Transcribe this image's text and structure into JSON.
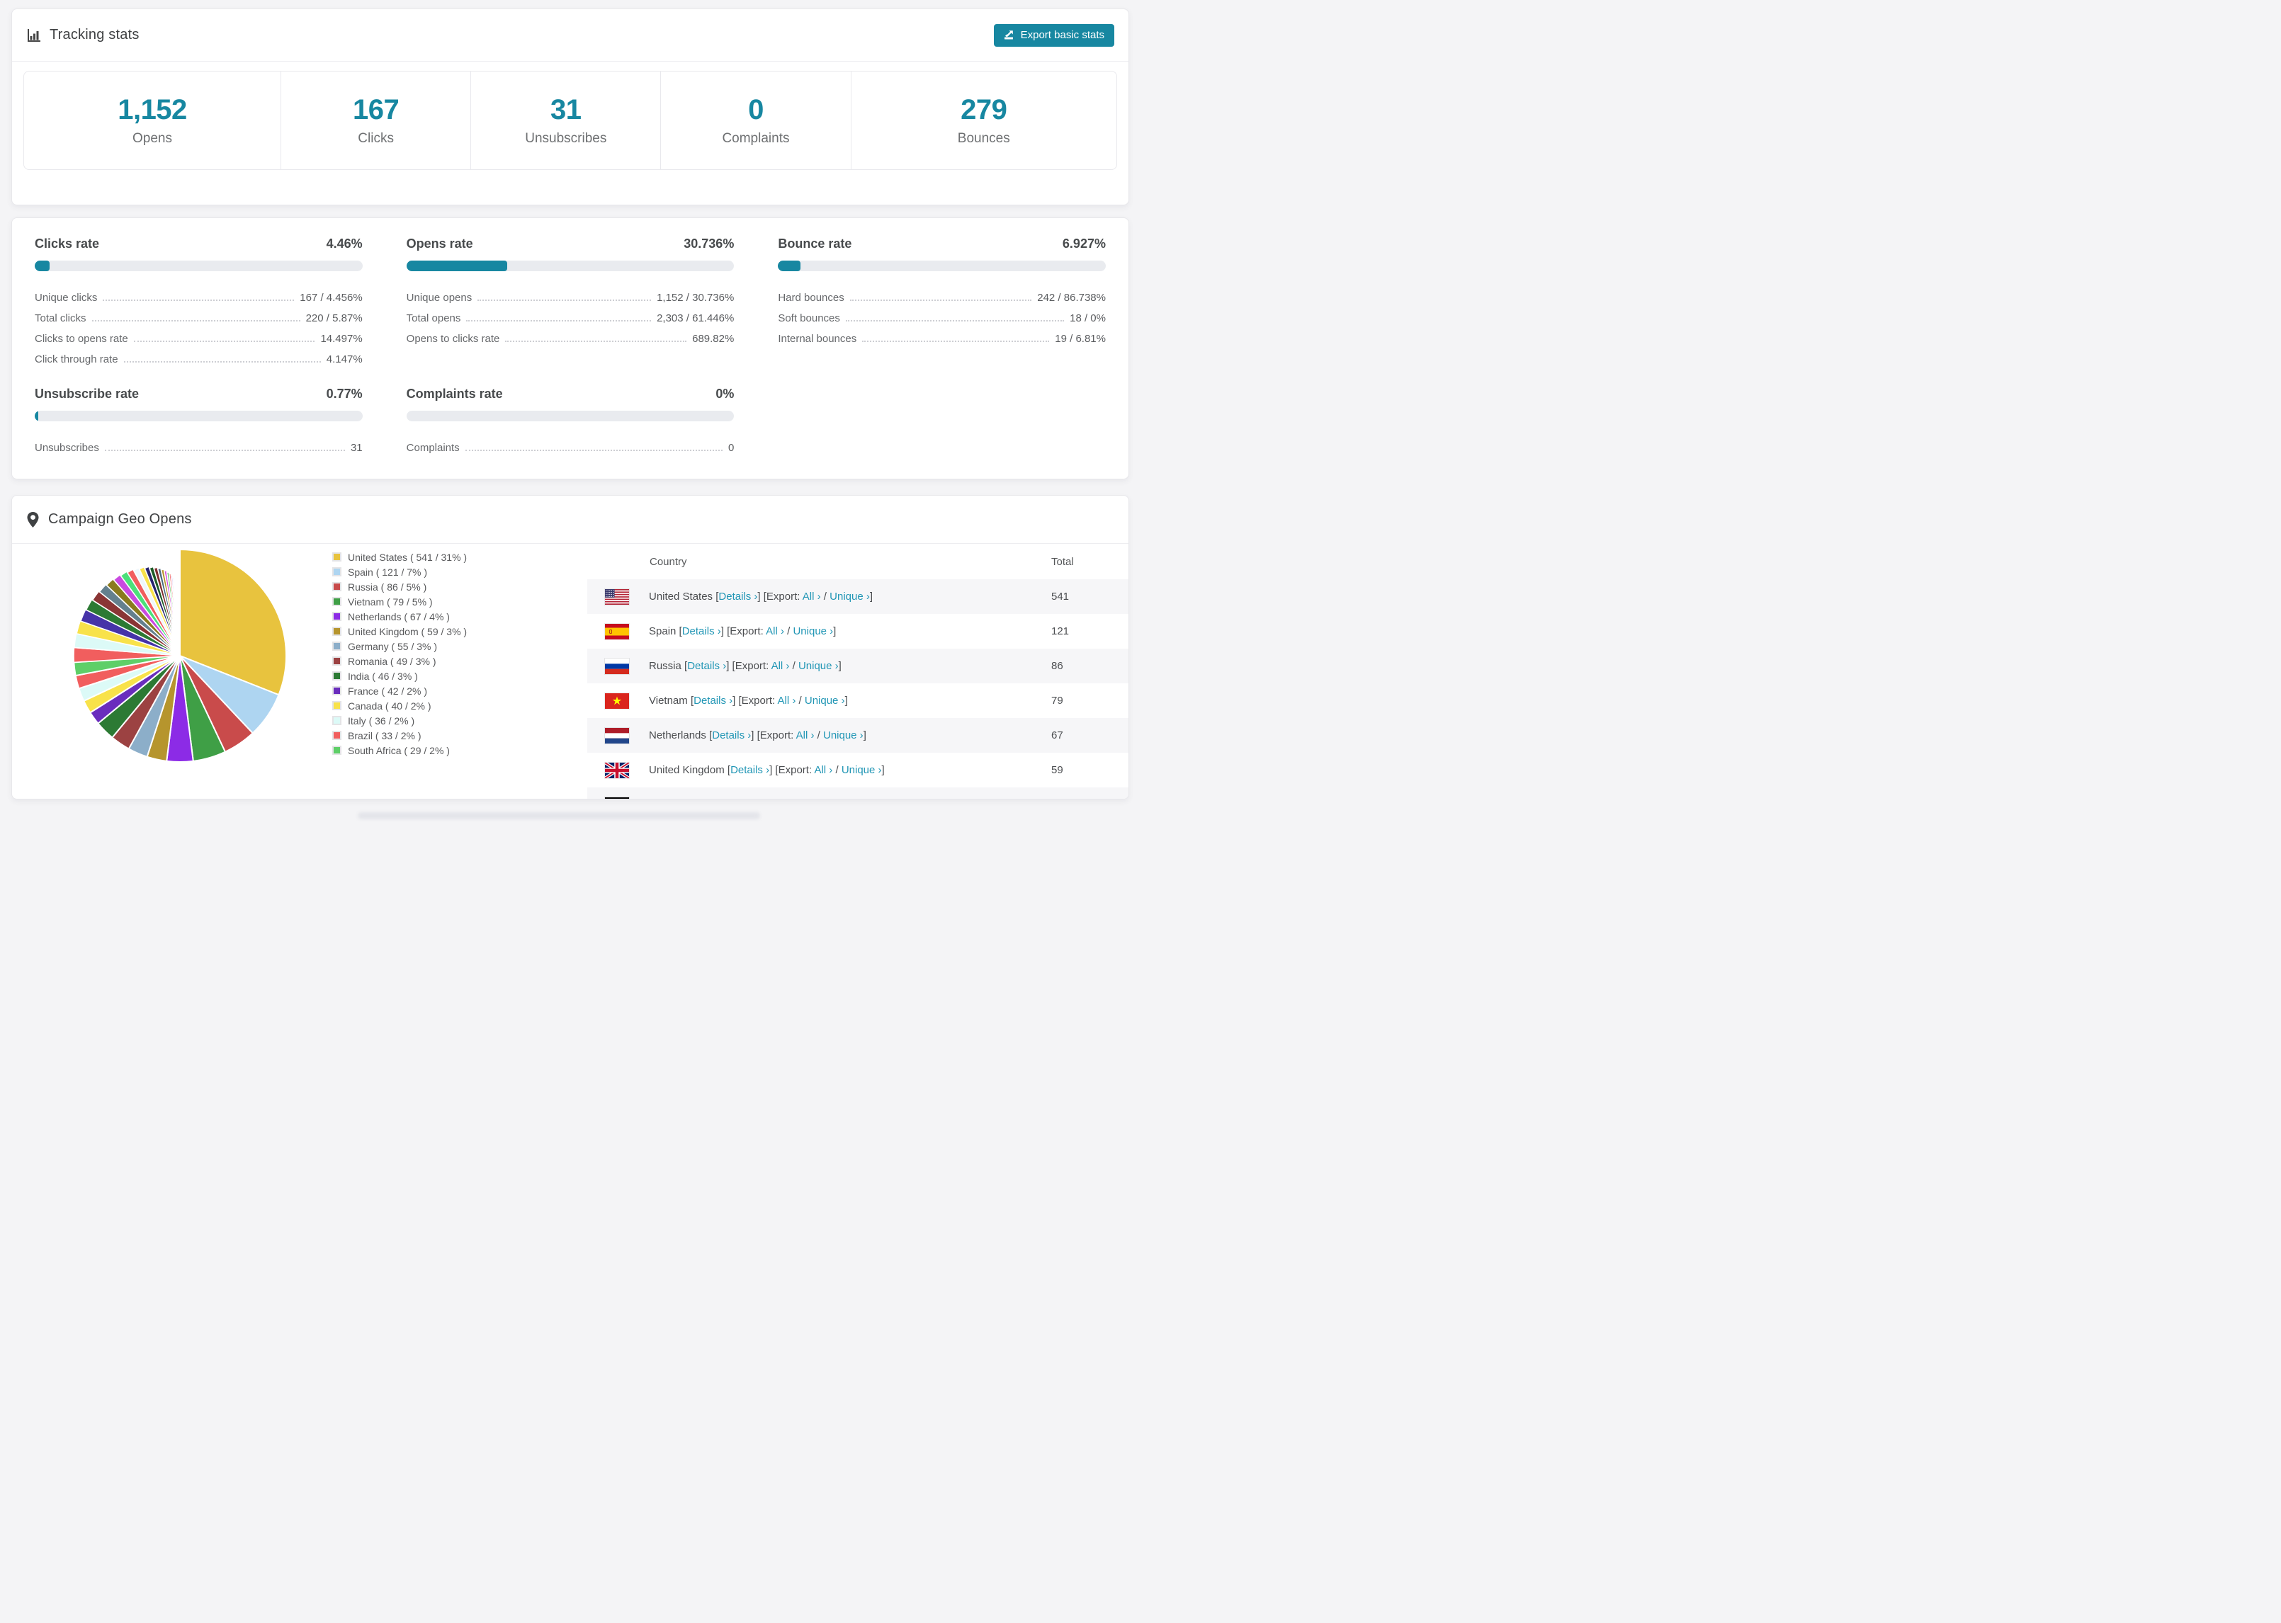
{
  "colors": {
    "accent": "#1787a1",
    "link": "#2196b5",
    "track": "#e9ebef",
    "page_bg": "#f4f4f6"
  },
  "tracking": {
    "title": "Tracking stats",
    "export_label": "Export basic stats",
    "stats": [
      {
        "value": "1,152",
        "label": "Opens"
      },
      {
        "value": "167",
        "label": "Clicks"
      },
      {
        "value": "31",
        "label": "Unsubscribes"
      },
      {
        "value": "0",
        "label": "Complaints"
      },
      {
        "value": "279",
        "label": "Bounces"
      }
    ]
  },
  "rates": [
    {
      "title": "Clicks rate",
      "value": "4.46%",
      "percent": 4.46,
      "rows": [
        [
          "Unique clicks",
          "167 / 4.456%"
        ],
        [
          "Total clicks",
          "220 / 5.87%"
        ],
        [
          "Clicks to opens rate",
          "14.497%"
        ],
        [
          "Click through rate",
          "4.147%"
        ]
      ]
    },
    {
      "title": "Opens rate",
      "value": "30.736%",
      "percent": 30.736,
      "rows": [
        [
          "Unique opens",
          "1,152 / 30.736%"
        ],
        [
          "Total opens",
          "2,303 / 61.446%"
        ],
        [
          "Opens to clicks rate",
          "689.82%"
        ]
      ]
    },
    {
      "title": "Bounce rate",
      "value": "6.927%",
      "percent": 6.927,
      "rows": [
        [
          "Hard bounces",
          "242 / 86.738%"
        ],
        [
          "Soft bounces",
          "18 / 0%"
        ],
        [
          "Internal bounces",
          "19 / 6.81%"
        ]
      ]
    },
    {
      "title": "Unsubscribe rate",
      "value": "0.77%",
      "percent": 0.77,
      "rows": [
        [
          "Unsubscribes",
          "31"
        ]
      ]
    },
    {
      "title": "Complaints rate",
      "value": "0%",
      "percent": 0,
      "rows": [
        [
          "Complaints",
          "0"
        ]
      ]
    }
  ],
  "geo": {
    "title": "Campaign Geo Opens",
    "table": {
      "col_country": "Country",
      "col_total": "Total",
      "details_label": "Details",
      "export_label": "Export:",
      "all_label": "All",
      "unique_label": "Unique",
      "chevron": "›",
      "rows": [
        {
          "country": "United States",
          "flag": "us",
          "total": "541"
        },
        {
          "country": "Spain",
          "flag": "es",
          "total": "121"
        },
        {
          "country": "Russia",
          "flag": "ru",
          "total": "86"
        },
        {
          "country": "Vietnam",
          "flag": "vn",
          "total": "79"
        },
        {
          "country": "Netherlands",
          "flag": "nl",
          "total": "67"
        },
        {
          "country": "United Kingdom",
          "flag": "gb",
          "total": "59"
        }
      ],
      "partial_row": {
        "flag": "de"
      }
    }
  },
  "chart_data": {
    "type": "pie",
    "title": "Campaign Geo Opens",
    "legend_position": "right",
    "start_angle_deg": -90,
    "direction": "clockwise",
    "slices": [
      {
        "label": "United States",
        "count": 541,
        "pct": 31,
        "color": "#e8c33e"
      },
      {
        "label": "Spain",
        "count": 121,
        "pct": 7,
        "color": "#aed5f1"
      },
      {
        "label": "Russia",
        "count": 86,
        "pct": 5,
        "color": "#c94b4b"
      },
      {
        "label": "Vietnam",
        "count": 79,
        "pct": 5,
        "color": "#3f9f46"
      },
      {
        "label": "Netherlands",
        "count": 67,
        "pct": 4,
        "color": "#8c2be6"
      },
      {
        "label": "United Kingdom",
        "count": 59,
        "pct": 3,
        "color": "#b6952d"
      },
      {
        "label": "Germany",
        "count": 55,
        "pct": 3,
        "color": "#8caec9"
      },
      {
        "label": "Romania",
        "count": 49,
        "pct": 3,
        "color": "#9c4242"
      },
      {
        "label": "India",
        "count": 46,
        "pct": 3,
        "color": "#2c7a34"
      },
      {
        "label": "France",
        "count": 42,
        "pct": 2,
        "color": "#6a2dbd"
      },
      {
        "label": "Canada",
        "count": 40,
        "pct": 2,
        "color": "#f8e24a"
      },
      {
        "label": "Italy",
        "count": 36,
        "pct": 2,
        "color": "#dcfaf7"
      },
      {
        "label": "Brazil",
        "count": 33,
        "pct": 2,
        "color": "#f15e5e"
      },
      {
        "label": "South Africa",
        "count": 29,
        "pct": 2,
        "color": "#5ecf68"
      }
    ],
    "others_total_pct": 26,
    "others": [
      {
        "w": 2.0,
        "c": "#f15e5e"
      },
      {
        "w": 1.9,
        "c": "#dcfaf7"
      },
      {
        "w": 1.8,
        "c": "#f8e24a"
      },
      {
        "w": 1.7,
        "c": "#4633a8"
      },
      {
        "w": 1.6,
        "c": "#2c7a34"
      },
      {
        "w": 1.5,
        "c": "#8a3535"
      },
      {
        "w": 1.35,
        "c": "#64808e"
      },
      {
        "w": 1.25,
        "c": "#8a7a1e"
      },
      {
        "w": 1.15,
        "c": "#c94ae0"
      },
      {
        "w": 1.05,
        "c": "#4be07a"
      },
      {
        "w": 0.95,
        "c": "#f15e5e"
      },
      {
        "w": 0.85,
        "c": "#eef7fb"
      },
      {
        "w": 0.78,
        "c": "#f8e24a"
      },
      {
        "w": 0.7,
        "c": "#28246e"
      },
      {
        "w": 0.63,
        "c": "#1e5c28"
      },
      {
        "w": 0.57,
        "c": "#7e2f2f"
      },
      {
        "w": 0.5,
        "c": "#4a6b82"
      },
      {
        "w": 0.45,
        "c": "#b6952d"
      },
      {
        "w": 0.4,
        "c": "#d24ae0"
      },
      {
        "w": 0.35,
        "c": "#5ecf68"
      },
      {
        "w": 0.31,
        "c": "#f15e5e"
      },
      {
        "w": 0.27,
        "c": "#cbb3f0"
      },
      {
        "w": 0.24,
        "c": "#aed5f1"
      },
      {
        "w": 0.21,
        "c": "#e8c33e"
      },
      {
        "w": 0.18,
        "c": "#c94b4b"
      },
      {
        "w": 0.15,
        "c": "#3f9f46"
      },
      {
        "w": 0.13,
        "c": "#8c2be6"
      },
      {
        "w": 0.11,
        "c": "#f8e24a"
      },
      {
        "w": 0.09,
        "c": "#dcfaf7"
      },
      {
        "w": 0.08,
        "c": "#f15e5e"
      },
      {
        "w": 0.06,
        "c": "#21468b"
      },
      {
        "w": 0.05,
        "c": "#b6952d"
      }
    ]
  }
}
